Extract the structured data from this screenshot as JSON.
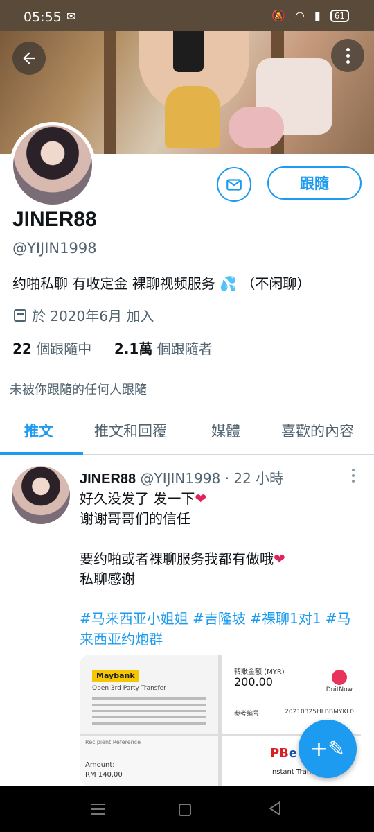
{
  "status_bar": {
    "time": "05:55",
    "battery": "61",
    "icons": [
      "wechat-icon",
      "mute-icon",
      "wifi-icon",
      "signal-icon",
      "battery-icon"
    ]
  },
  "profile": {
    "name": "JINER88",
    "handle": "@YIJIN1998",
    "bio": "约啪私聊 有收定金 裸聊视频服务",
    "bio_suffix": "（不闲聊）",
    "joined": "於 2020年6月 加入",
    "following_count": "22",
    "following_label": "個跟隨中",
    "followers_count": "2.1萬",
    "followers_label": "個跟隨者",
    "not_followed_notice": "未被你跟隨的任何人跟隨",
    "follow_button": "跟隨"
  },
  "tabs": [
    {
      "label": "推文",
      "active": true
    },
    {
      "label": "推文和回覆",
      "active": false
    },
    {
      "label": "媒體",
      "active": false
    },
    {
      "label": "喜歡的內容",
      "active": false
    }
  ],
  "tweet": {
    "name": "JINER88",
    "handle": "@YIJIN1998",
    "time": "· 22 小時",
    "lines": [
      "好久没发了 发一下",
      "谢谢哥哥们的信任",
      "",
      "要约啪或者裸聊服务我都有做哦",
      "私聊感谢"
    ],
    "hashtags": "#马来西亚小姐姐 #吉隆坡 #裸聊1对1 #马来西亚约炮群",
    "media": {
      "img1_brand": "Maybank",
      "img1_title": "Open 3rd Party Transfer",
      "img2_label": "转账金额 (MYR)",
      "img2_amount": "200.00",
      "img2_logo": "DuitNow",
      "img2_ref_label": "参考编号",
      "img2_ref": "20210325HLBBMYKL0",
      "img3_ref_label": "Recipient Reference",
      "img3_amount_label": "Amount:",
      "img3_amount": "RM 140.00",
      "img4_brand_a": "PB",
      "img4_brand_b": "e",
      "img4_caption": "Instant Transfer"
    }
  },
  "colors": {
    "accent": "#1d9bf0",
    "heart": "#e0245e",
    "secondary_text": "#536471"
  }
}
